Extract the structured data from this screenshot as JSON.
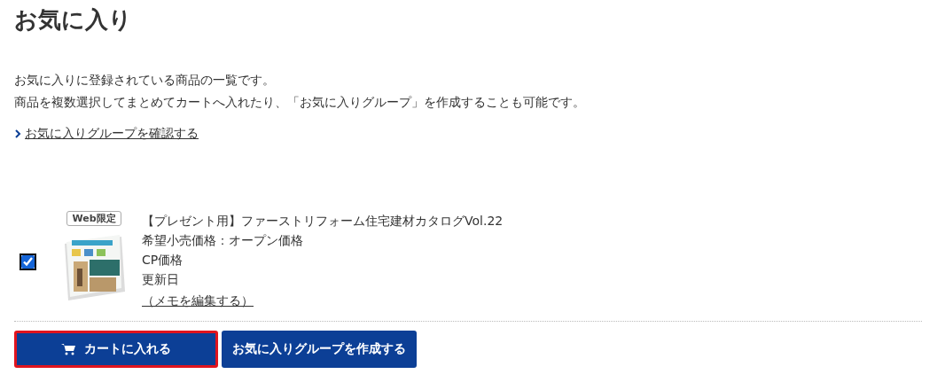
{
  "title": "お気に入り",
  "description": [
    "お気に入りに登録されている商品の一覧です。",
    "商品を複数選択してまとめてカートへ入れたり、「お気に入りグループ」を作成することも可能です。"
  ],
  "group_link": {
    "label": "お気に入りグループを確認する"
  },
  "items": [
    {
      "checked": true,
      "badge": "Web限定",
      "name": "【プレゼント用】ファーストリフォーム住宅建材カタログVol.22",
      "lines": [
        "希望小売価格：オープン価格",
        "CP価格",
        "更新日"
      ],
      "memo_link": "（メモを編集する）"
    }
  ],
  "buttons": [
    {
      "kind": "cart",
      "label": "カートに入れる",
      "highlighted": true
    },
    {
      "kind": "group",
      "label": "お気に入りグループを作成する",
      "highlighted": false
    }
  ]
}
